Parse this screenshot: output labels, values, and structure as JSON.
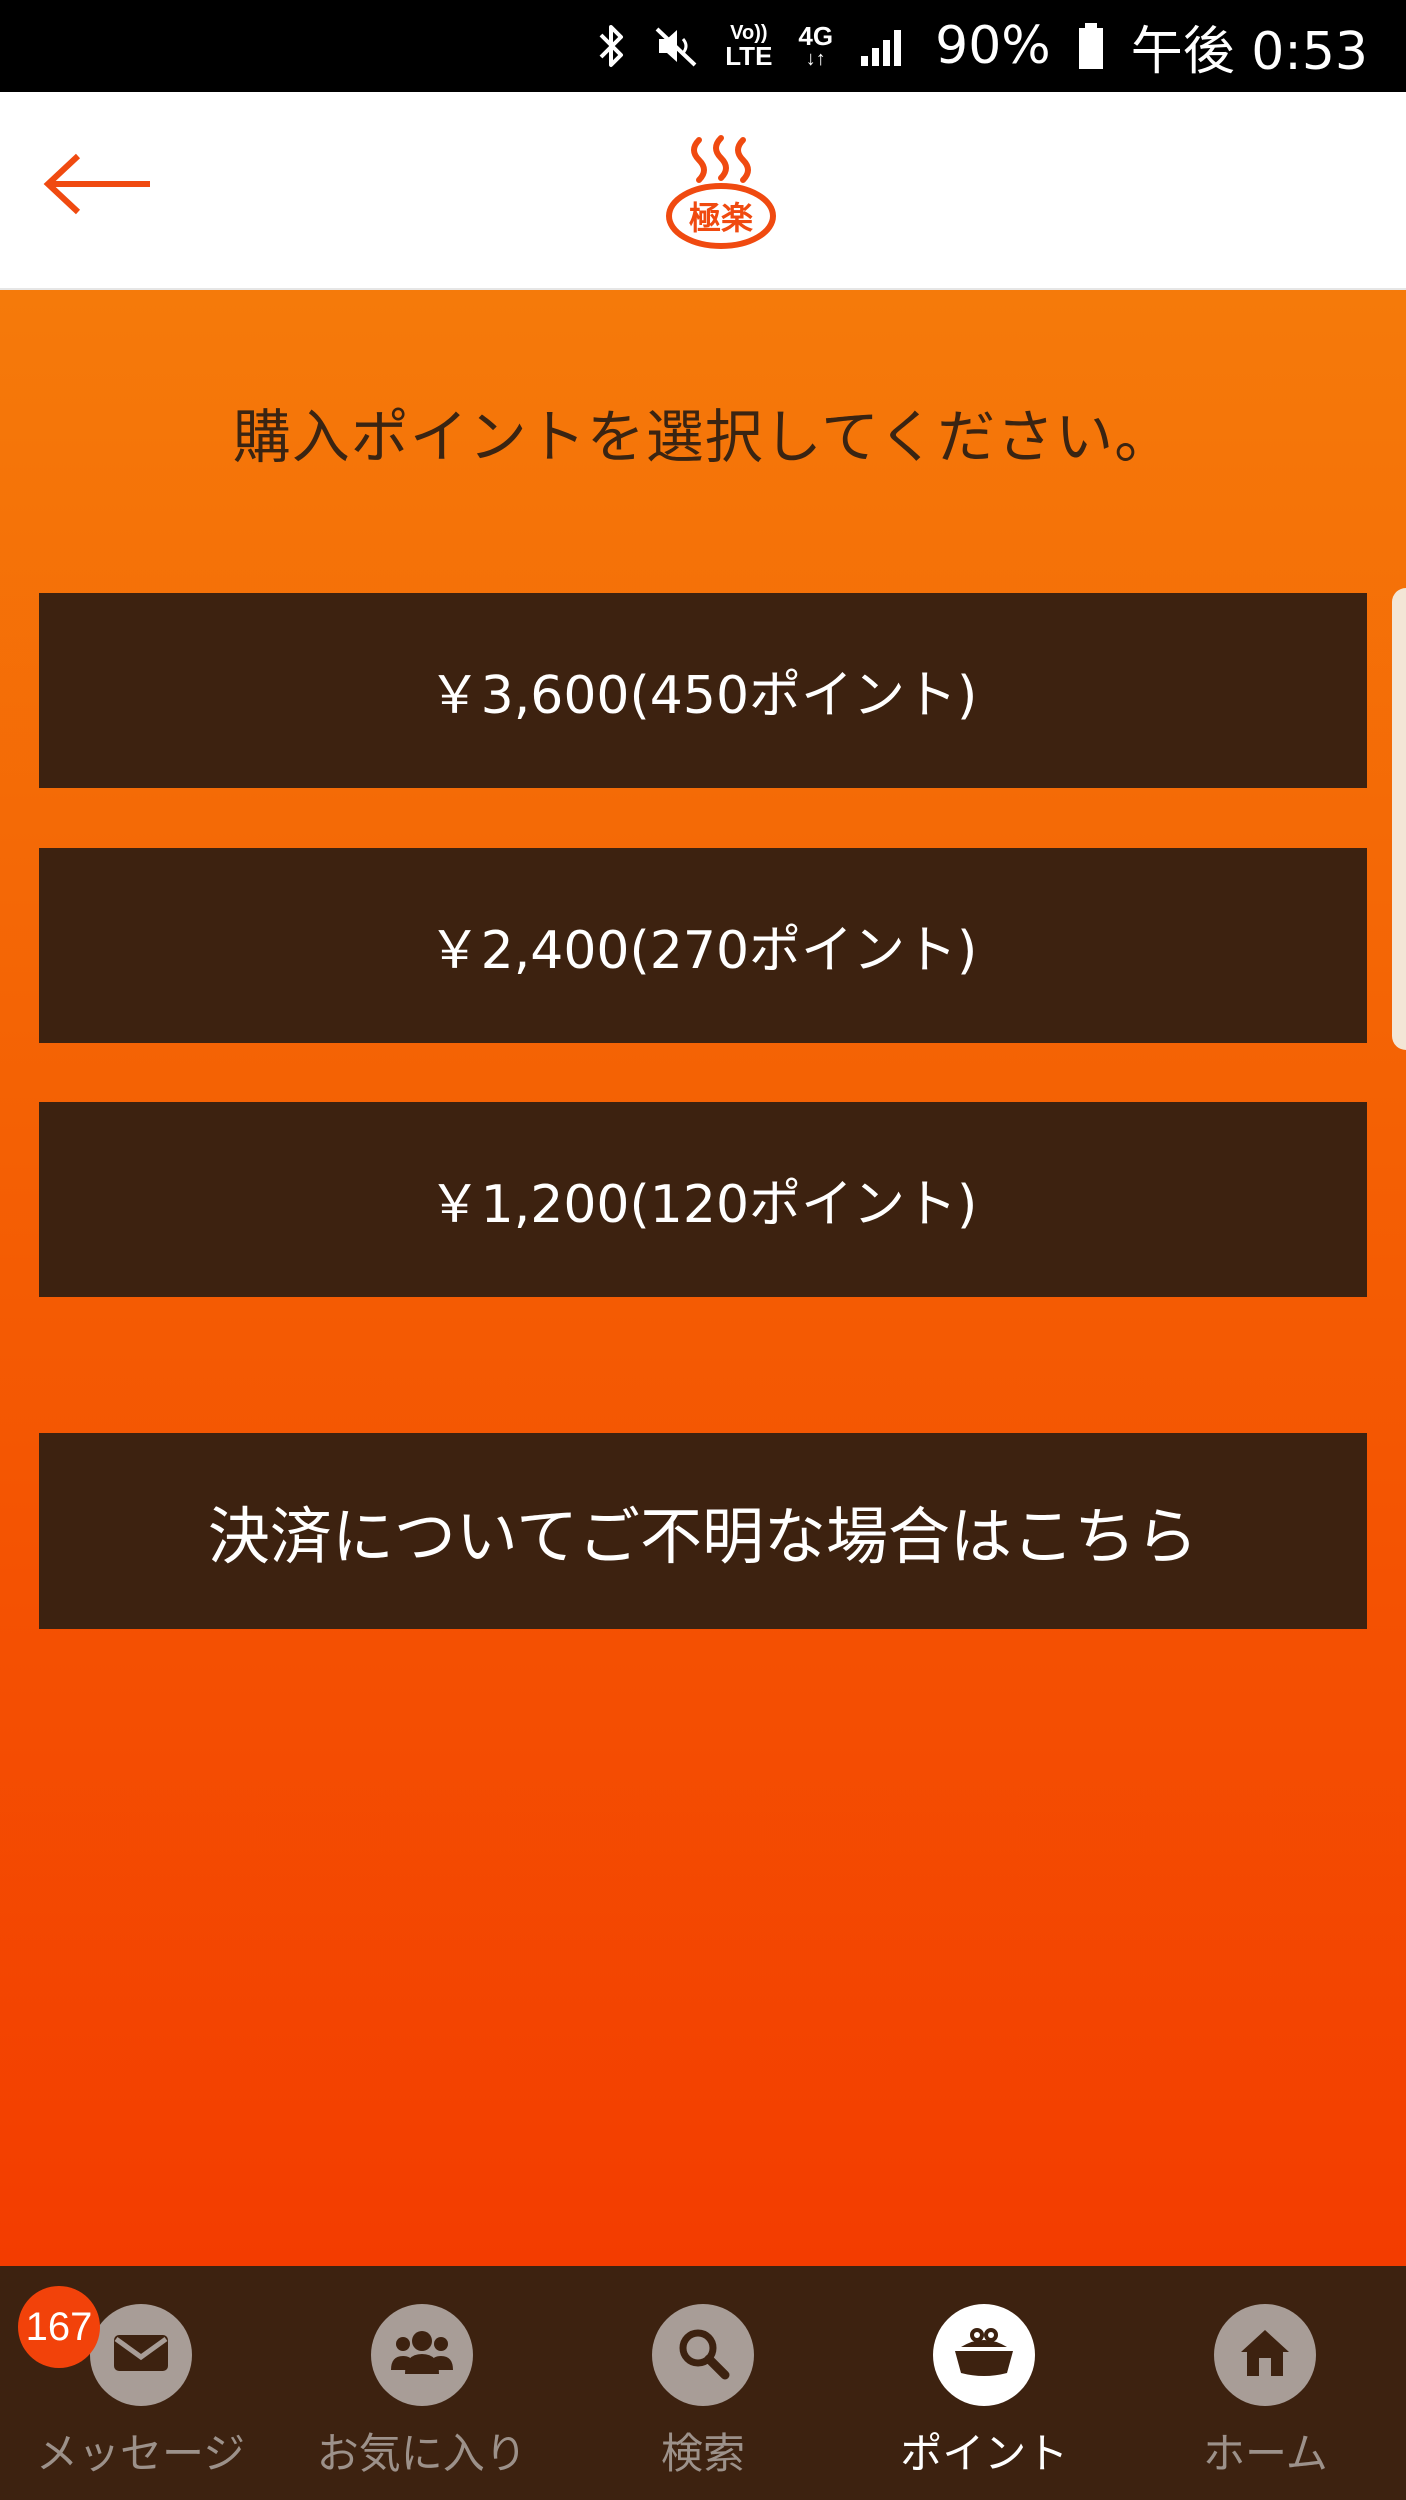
{
  "status_bar": {
    "volte_top": "Vo))",
    "volte_bottom": "LTE",
    "network_top": "4G",
    "network_bottom": "↓↑",
    "battery": "90%",
    "time": "午後 0:53"
  },
  "header": {
    "logo_text": "極楽"
  },
  "main": {
    "prompt": "購入ポイントを選択してください。",
    "options": [
      {
        "label": "￥3,600(450ポイント)"
      },
      {
        "label": "￥2,400(270ポイント)"
      },
      {
        "label": "￥1,200(120ポイント)"
      }
    ],
    "help_label": "決済についてご不明な場合はこちら"
  },
  "bottom_nav": {
    "message_badge": "167",
    "items": [
      {
        "label": "メッセージ",
        "icon": "mail-icon"
      },
      {
        "label": "お気に入り",
        "icon": "people-icon"
      },
      {
        "label": "検索",
        "icon": "search-icon"
      },
      {
        "label": "ポイント",
        "icon": "purse-icon"
      },
      {
        "label": "ホーム",
        "icon": "home-icon"
      }
    ],
    "active_index": 3
  },
  "colors": {
    "accent": "#f04a10",
    "nav_background": "#3d2210",
    "button_background": "#3d2210",
    "gradient_top": "#f57a0a",
    "gradient_bottom": "#f33c00"
  }
}
